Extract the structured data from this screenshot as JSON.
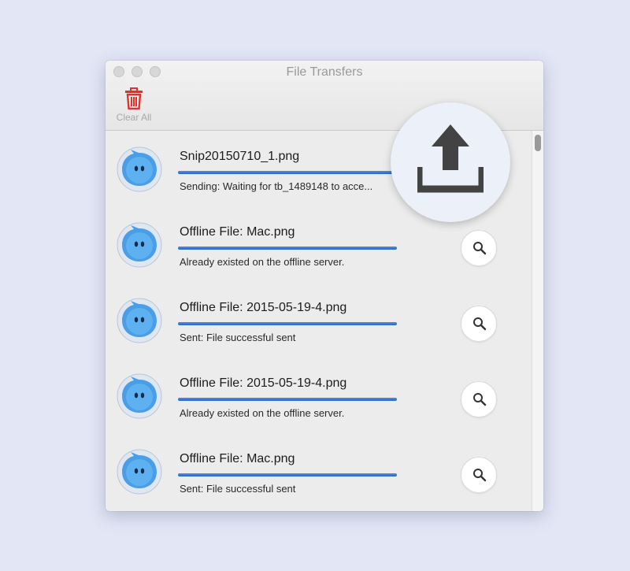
{
  "window": {
    "title": "File Transfers"
  },
  "toolbar": {
    "clear_all_label": "Clear All"
  },
  "transfers": [
    {
      "filename": "Snip20150710_1.png",
      "status": "Sending: Waiting for tb_1489148 to acce...",
      "progress": 0.9,
      "has_search": false
    },
    {
      "filename": "Offline File: Mac.png",
      "status": "Already existed on the offline server.",
      "progress": 1.0,
      "has_search": true
    },
    {
      "filename": "Offline File: 2015-05-19-4.png",
      "status": "Sent: File successful sent",
      "progress": 1.0,
      "has_search": true
    },
    {
      "filename": "Offline File: 2015-05-19-4.png",
      "status": "Already existed on the offline server.",
      "progress": 1.0,
      "has_search": true
    },
    {
      "filename": "Offline File: Mac.png",
      "status": "Sent: File successful sent",
      "progress": 1.0,
      "has_search": true
    }
  ],
  "icons": {
    "clear": "trash-icon",
    "avatar": "chat-bubble-avatar-icon",
    "search": "magnifier-icon",
    "upload": "upload-tray-icon"
  },
  "colors": {
    "accent_red": "#e0322b",
    "progress_blue": "#3a78d8",
    "background": "#e2e6f5"
  }
}
